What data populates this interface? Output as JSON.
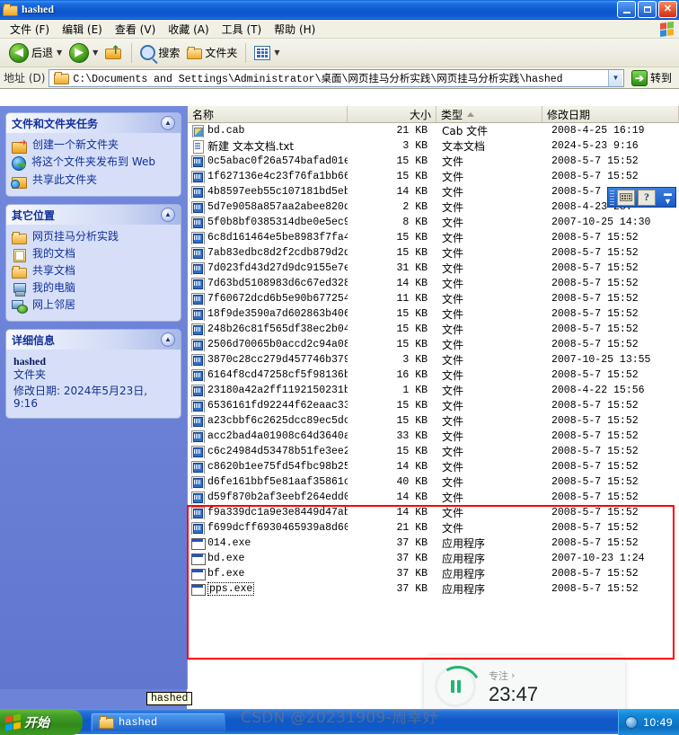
{
  "window": {
    "title": "hashed",
    "icon": "folder-icon",
    "buttons": {
      "minimize": "_",
      "maximize": "❐",
      "close": "✕"
    }
  },
  "menubar": {
    "items": [
      {
        "label": "文件 (F)",
        "name": "menu-file"
      },
      {
        "label": "编辑 (E)",
        "name": "menu-edit"
      },
      {
        "label": "查看 (V)",
        "name": "menu-view"
      },
      {
        "label": "收藏 (A)",
        "name": "menu-favorites"
      },
      {
        "label": "工具 (T)",
        "name": "menu-tools"
      },
      {
        "label": "帮助 (H)",
        "name": "menu-help"
      }
    ]
  },
  "toolbar": {
    "back_label": "后退",
    "forward_label": "",
    "up_label": "",
    "search_label": "搜索",
    "folders_label": "文件夹",
    "views_label": ""
  },
  "address": {
    "label": "地址 (D)",
    "path": "C:\\Documents and Settings\\Administrator\\桌面\\网页挂马分析实践\\网页挂马分析实践\\hashed",
    "go_label": "转到"
  },
  "sidebar": {
    "tasks_panel": {
      "title": "文件和文件夹任务",
      "items": [
        {
          "label": "创建一个新文件夹",
          "icon": "new-folder-icon"
        },
        {
          "label": "将这个文件夹发布到 Web",
          "icon": "publish-web-icon"
        },
        {
          "label": "共享此文件夹",
          "icon": "share-folder-icon"
        }
      ]
    },
    "places_panel": {
      "title": "其它位置",
      "items": [
        {
          "label": "网页挂马分析实践",
          "icon": "folder-icon"
        },
        {
          "label": "我的文档",
          "icon": "my-documents-icon"
        },
        {
          "label": "共享文档",
          "icon": "folder-icon"
        },
        {
          "label": "我的电脑",
          "icon": "my-computer-icon"
        },
        {
          "label": "网上邻居",
          "icon": "network-places-icon"
        }
      ]
    },
    "details_panel": {
      "title": "详细信息",
      "name": "hashed",
      "kind": "文件夹",
      "modified": "修改日期: 2024年5月23日, 9:16"
    }
  },
  "filelist": {
    "columns": [
      {
        "label": "名称",
        "name": "column-name"
      },
      {
        "label": "大小",
        "name": "column-size"
      },
      {
        "label": "类型",
        "name": "column-type",
        "sorted": "asc"
      },
      {
        "label": "修改日期",
        "name": "column-date"
      }
    ],
    "rows": [
      {
        "name": "bd.cab",
        "size": "21 KB",
        "type": "Cab 文件",
        "date": "2008-4-25 16:19",
        "icon": "cab-file-icon"
      },
      {
        "name": "新建 文本文档.txt",
        "size": "3 KB",
        "type": "文本文档",
        "date": "2024-5-23 9:16",
        "icon": "text-file-icon",
        "cjk": true
      },
      {
        "name": "0c5abac0f26a574bafad01e...",
        "size": "15 KB",
        "type": "文件",
        "date": "2008-5-7 15:52",
        "icon": "generic-file-icon"
      },
      {
        "name": "1f627136e4c23f76fa1bb66...",
        "size": "15 KB",
        "type": "文件",
        "date": "2008-5-7 15:52",
        "icon": "generic-file-icon"
      },
      {
        "name": "4b8597eeb55c107181bd5eb...",
        "size": "14 KB",
        "type": "文件",
        "date": "2008-5-7 15:52",
        "icon": "generic-file-icon"
      },
      {
        "name": "5d7e9058a857aa2abee820d...",
        "size": "2 KB",
        "type": "文件",
        "date": "2008-4-23 23:",
        "icon": "generic-file-icon"
      },
      {
        "name": "5f0b8bf0385314dbe0e5ec9...",
        "size": "8 KB",
        "type": "文件",
        "date": "2007-10-25 14:30",
        "icon": "generic-file-icon"
      },
      {
        "name": "6c8d161464e5be8983f7fa4...",
        "size": "15 KB",
        "type": "文件",
        "date": "2008-5-7 15:52",
        "icon": "generic-file-icon"
      },
      {
        "name": "7ab83edbc8d2f2cdb879d2d...",
        "size": "15 KB",
        "type": "文件",
        "date": "2008-5-7 15:52",
        "icon": "generic-file-icon"
      },
      {
        "name": "7d023fd43d27d9dc9155e7e...",
        "size": "31 KB",
        "type": "文件",
        "date": "2008-5-7 15:52",
        "icon": "generic-file-icon"
      },
      {
        "name": "7d63bd5108983d6c67ed328...",
        "size": "14 KB",
        "type": "文件",
        "date": "2008-5-7 15:52",
        "icon": "generic-file-icon"
      },
      {
        "name": "7f60672dcd6b5e90b677254...",
        "size": "11 KB",
        "type": "文件",
        "date": "2008-5-7 15:52",
        "icon": "generic-file-icon"
      },
      {
        "name": "18f9de3590a7d602863b406...",
        "size": "15 KB",
        "type": "文件",
        "date": "2008-5-7 15:52",
        "icon": "generic-file-icon"
      },
      {
        "name": "248b26c81f565df38ec2b04...",
        "size": "15 KB",
        "type": "文件",
        "date": "2008-5-7 15:52",
        "icon": "generic-file-icon"
      },
      {
        "name": "2506d70065b0accd2c94a08...",
        "size": "15 KB",
        "type": "文件",
        "date": "2008-5-7 15:52",
        "icon": "generic-file-icon"
      },
      {
        "name": "3870c28cc279d457746b379...",
        "size": "3 KB",
        "type": "文件",
        "date": "2007-10-25 13:55",
        "icon": "generic-file-icon"
      },
      {
        "name": "6164f8cd47258cf5f98136b...",
        "size": "16 KB",
        "type": "文件",
        "date": "2008-5-7 15:52",
        "icon": "generic-file-icon"
      },
      {
        "name": "23180a42a2ff1192150231b...",
        "size": "1 KB",
        "type": "文件",
        "date": "2008-4-22 15:56",
        "icon": "generic-file-icon"
      },
      {
        "name": "6536161fd92244f62eaac33...",
        "size": "15 KB",
        "type": "文件",
        "date": "2008-5-7 15:52",
        "icon": "generic-file-icon"
      },
      {
        "name": "a23cbbf6c2625dcc89ec5dc...",
        "size": "15 KB",
        "type": "文件",
        "date": "2008-5-7 15:52",
        "icon": "generic-file-icon"
      },
      {
        "name": "acc2bad4a01908c64d3640a...",
        "size": "33 KB",
        "type": "文件",
        "date": "2008-5-7 15:52",
        "icon": "generic-file-icon"
      },
      {
        "name": "c6c24984d53478b51fe3ee2...",
        "size": "15 KB",
        "type": "文件",
        "date": "2008-5-7 15:52",
        "icon": "generic-file-icon"
      },
      {
        "name": "c8620b1ee75fd54fbc98b25...",
        "size": "14 KB",
        "type": "文件",
        "date": "2008-5-7 15:52",
        "icon": "generic-file-icon"
      },
      {
        "name": "d6fe161bbf5e81aaf35861c...",
        "size": "40 KB",
        "type": "文件",
        "date": "2008-5-7 15:52",
        "icon": "generic-file-icon"
      },
      {
        "name": "d59f870b2af3eebf264edd0...",
        "size": "14 KB",
        "type": "文件",
        "date": "2008-5-7 15:52",
        "icon": "generic-file-icon"
      },
      {
        "name": "f9a339dc1a9e3e8449d47ab...",
        "size": "14 KB",
        "type": "文件",
        "date": "2008-5-7 15:52",
        "icon": "generic-file-icon"
      },
      {
        "name": "f699dcff6930465939a8d60...",
        "size": "21 KB",
        "type": "文件",
        "date": "2008-5-7 15:52",
        "icon": "generic-file-icon"
      },
      {
        "name": "014.exe",
        "size": "37 KB",
        "type": "应用程序",
        "date": "2008-5-7 15:52",
        "icon": "executable-icon"
      },
      {
        "name": "bd.exe",
        "size": "37 KB",
        "type": "应用程序",
        "date": "2007-10-23 1:24",
        "icon": "executable-icon"
      },
      {
        "name": "bf.exe",
        "size": "37 KB",
        "type": "应用程序",
        "date": "2008-5-7 15:52",
        "icon": "executable-icon"
      },
      {
        "name": "pps.exe",
        "size": "37 KB",
        "type": "应用程序",
        "date": "2008-5-7 15:52",
        "icon": "executable-icon",
        "focused": true
      }
    ]
  },
  "annotation": {
    "color": "#ff0000",
    "shape": "rectangle"
  },
  "ime_bar": {
    "keyboard_icon": "keyboard-icon",
    "help_icon": "help-icon"
  },
  "timer_widget": {
    "label": "专注",
    "chevron": "›",
    "time": "23:47",
    "state": "paused"
  },
  "tooltip": {
    "text": "hashed"
  },
  "taskbar": {
    "start_label": "开始",
    "tasks": [
      {
        "label": "hashed",
        "icon": "folder-icon"
      }
    ],
    "tray_time": "10:49"
  },
  "watermark": {
    "text": "CSDN @20231909-周幸妤"
  }
}
